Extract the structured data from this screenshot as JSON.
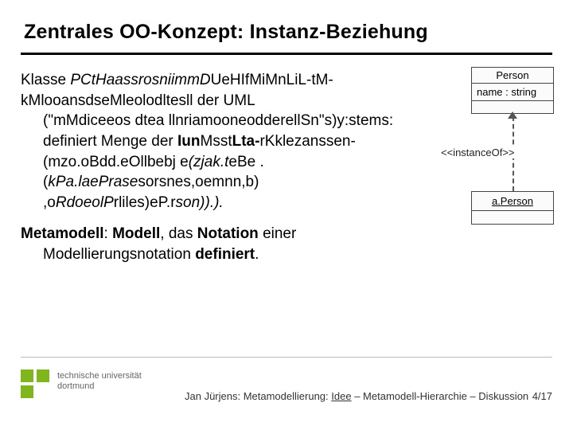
{
  "title": "Zentrales OO-Konzept: Instanz-Beziehung",
  "para1": {
    "l1_pre": "Klasse ",
    "l1_overlap": "PCtHaassrosniimmD",
    "l1_mid": "U",
    "l1_overlap2": "eHIfMiMnLiL-tM-",
    "l1_post1": "kMlooansdseMleolodltesll der UML",
    "l2_ov1": "(\"mMdiceeo",
    "l2_ov2": "s dtea lln",
    "l2_ov3": "riamooneodderellSn\"s)y",
    "l2_post": ":stems:",
    "l3_pre": "definiert Menge der ",
    "l3_ov1": "Iun",
    "l3_ov2": "Msst",
    "l3_ov3": "Lta-",
    "l3_ov4": "rKklezans",
    "l3_post": "sen-",
    "l4_ov1": "(mzo.oBdd.eO",
    "l4_ov2": "llbebj e",
    "l4_ov3": "(zjak.t",
    "l4_ov4": "eBe .(",
    "l4_ov5": "kPa.laePrase",
    "l4_ov6": "sorsnes,oe",
    "l4_ov7": "mnn,b) ,o",
    "l4_ov8": "RdoeolP",
    "l4_ov9": "rliles)eP.r",
    "l4_post": "son)).)."
  },
  "para2": {
    "l1_b1": "Metamodell",
    "l1_mid": ": ",
    "l1_b2": "Modell",
    "l1_mid2": ", das ",
    "l1_b3": "Notation",
    "l1_post": " einer",
    "l2_pre": "Modellierungsnotation ",
    "l2_b1": "definiert",
    "l2_post": "."
  },
  "diagram": {
    "class_name": "Person",
    "class_attr": "name : string",
    "stereotype": "<<instanceOf>>",
    "object_name": "a.Person"
  },
  "logo": {
    "line1": "technische universität",
    "line2": "dortmund"
  },
  "footer": {
    "author": "Jan Jürjens:  Metamodellierung:  ",
    "nav1": "Idee",
    "sep": "  –  ",
    "nav2": "Metamodell-Hierarchie",
    "nav3": "Diskussion",
    "page": "4/17"
  }
}
